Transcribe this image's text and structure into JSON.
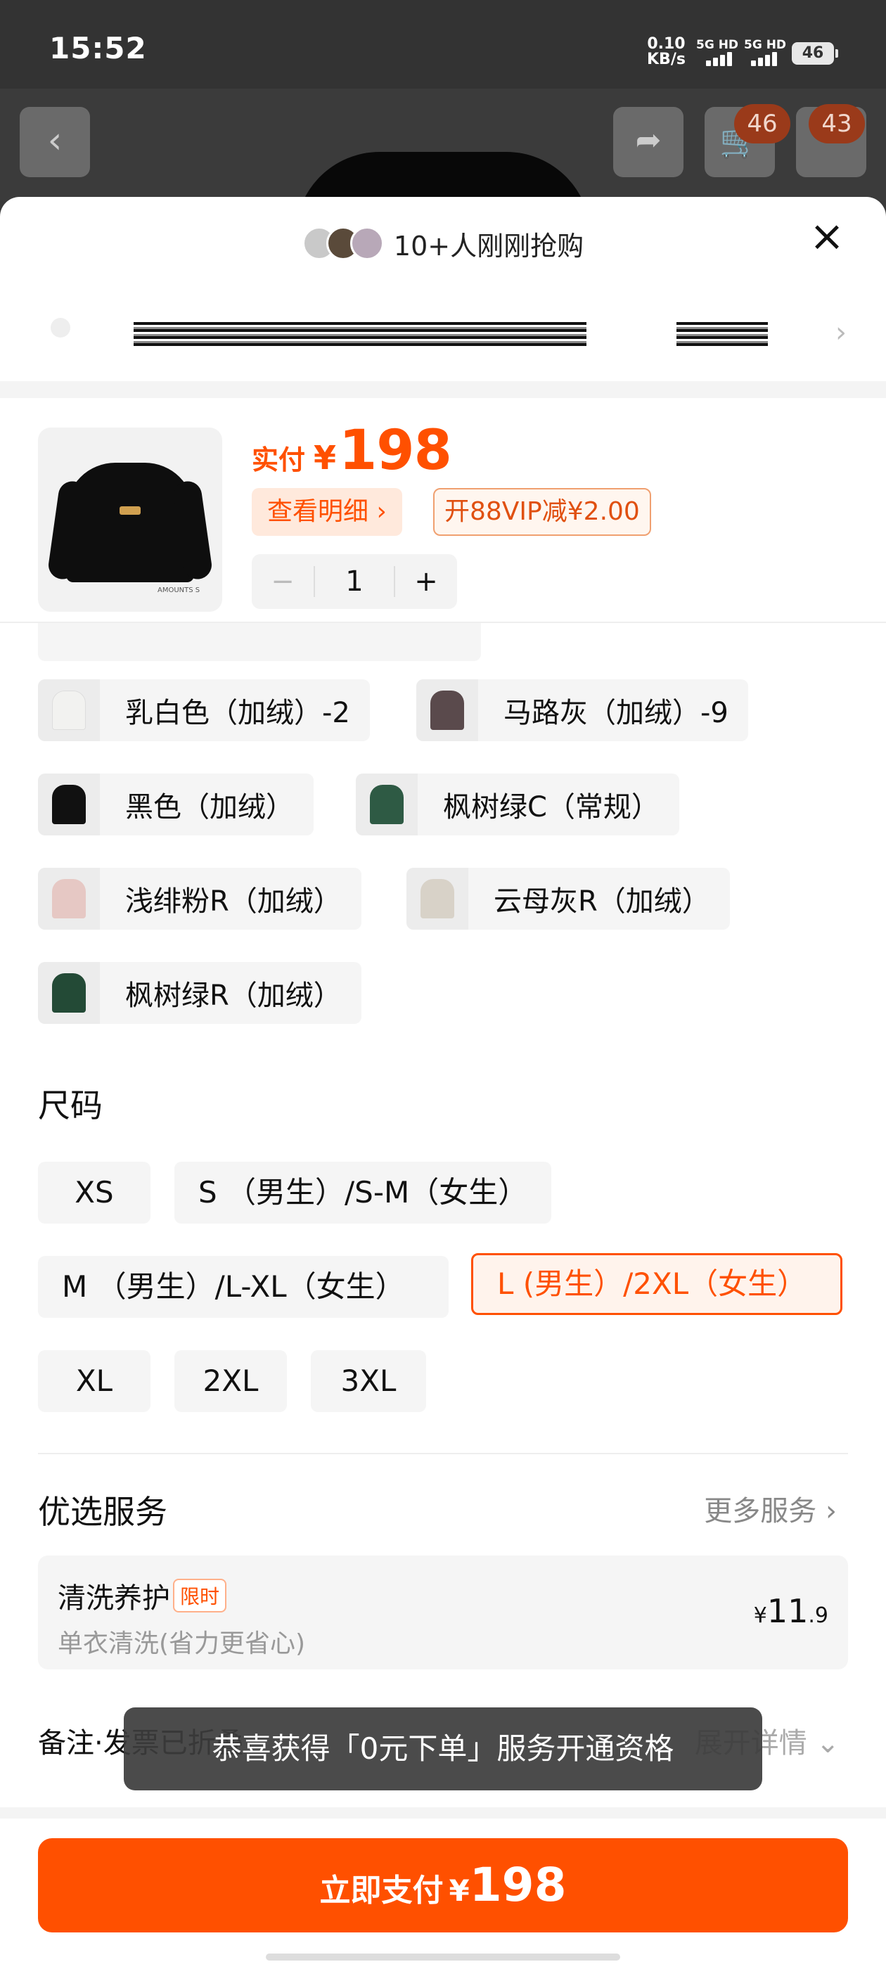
{
  "status_bar": {
    "time": "15:52",
    "net_speed_value": "0.10",
    "net_speed_unit": "KB/s",
    "sim1": "5G HD",
    "sim2": "5G HD",
    "battery": "46"
  },
  "background_page": {
    "cart_badge": "46",
    "message_badge": "43"
  },
  "sheet": {
    "buyers_text": "10+人刚刚抢购",
    "product": {
      "price_label": "实付",
      "currency": "¥",
      "price": "198",
      "detail_button": "查看明细 ›",
      "vip_tag": "开88VIP减¥2.00",
      "quantity": "1",
      "minus": "−",
      "plus": "+",
      "brand_small": "AMOUNTS S"
    },
    "colors": [
      {
        "label": "乳白色（加绒）-2",
        "swatch": "#f2f2f0"
      },
      {
        "label": "马路灰（加绒）-9",
        "swatch": "#5a4a4c"
      },
      {
        "label": "黑色（加绒）",
        "swatch": "#111111"
      },
      {
        "label": "枫树绿C（常规）",
        "swatch": "#2e5a44"
      },
      {
        "label": "浅绯粉R（加绒）",
        "swatch": "#e6c8c4"
      },
      {
        "label": "云母灰R（加绒）",
        "swatch": "#d8d2c8"
      },
      {
        "label": "枫树绿R（加绒）",
        "swatch": "#234a36"
      }
    ],
    "size_title": "尺码",
    "sizes": [
      {
        "label": "XS",
        "selected": false
      },
      {
        "label": "S （男生）/S-M（女生）",
        "selected": false
      },
      {
        "label": "M （男生）/L-XL（女生）",
        "selected": false
      },
      {
        "label": "L (男生）/2XL（女生）",
        "selected": true
      },
      {
        "label": "XL",
        "selected": false
      },
      {
        "label": "2XL",
        "selected": false
      },
      {
        "label": "3XL",
        "selected": false
      }
    ],
    "service_title": "优选服务",
    "more_services": "更多服务 ›",
    "service": {
      "name": "清洗养护",
      "tag": "限时",
      "desc": "单衣清洗(省力更省心)",
      "currency": "¥",
      "price_int": "11",
      "price_dec": ".9"
    },
    "remark": "备注·发票已折叠",
    "expand": "展开详情 ⌄",
    "toast": "恭喜获得「0元下单」服务开通资格",
    "pay_button": {
      "text": "立即支付",
      "currency": "¥",
      "amount": "198"
    }
  },
  "colors_theme": {
    "accent": "#ff5000",
    "accent_bg": "#fff3ec"
  }
}
